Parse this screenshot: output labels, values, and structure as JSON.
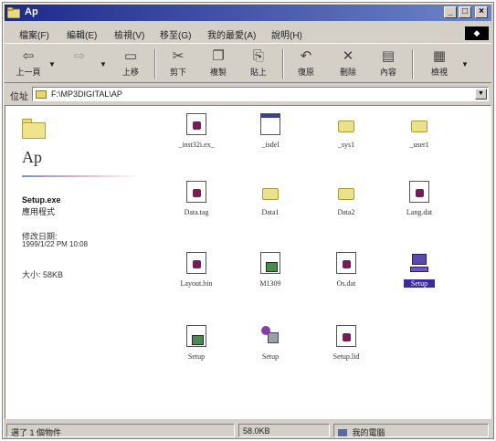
{
  "window": {
    "title": "Ap",
    "min_btn": "_",
    "max_btn": "□",
    "close_btn": "×"
  },
  "menu": {
    "items": [
      "檔案(F)",
      "編輯(E)",
      "檢視(V)",
      "移至(G)",
      "我的最愛(A)",
      "說明(H)"
    ],
    "throbber": "◆"
  },
  "toolbar": {
    "back": {
      "label": "上一頁",
      "glyph": "⇦"
    },
    "forward": {
      "label": "",
      "glyph": "⇨"
    },
    "up": {
      "label": "上移",
      "glyph": "▭"
    },
    "cut": {
      "label": "剪下",
      "glyph": "✂"
    },
    "copy": {
      "label": "複製",
      "glyph": "❐"
    },
    "paste": {
      "label": "貼上",
      "glyph": "⎘"
    },
    "undo": {
      "label": "復原",
      "glyph": "↶"
    },
    "delete": {
      "label": "刪除",
      "glyph": "✕"
    },
    "properties": {
      "label": "內容",
      "glyph": "▤"
    },
    "views": {
      "label": "檢視",
      "glyph": "▦"
    }
  },
  "address": {
    "label": "位址",
    "path": "F:\\MP3DIGITAL\\AP"
  },
  "left_panel": {
    "folder_title": "Ap",
    "file_name": "Setup.exe",
    "file_type": "應用程式",
    "modified_label": "修改日期:",
    "modified_date": "1999/1/22 PM 10:08",
    "size_text": "大小: 58KB"
  },
  "files": [
    {
      "name": "_inst32i.ex_",
      "icon": "document-icon"
    },
    {
      "name": "_isdel",
      "icon": "window-icon"
    },
    {
      "name": "_sys1",
      "icon": "folder-icon"
    },
    {
      "name": "_user1",
      "icon": "folder-icon"
    },
    {
      "name": "Data.tag",
      "icon": "document-icon"
    },
    {
      "name": "Data1",
      "icon": "folder-icon"
    },
    {
      "name": "Data2",
      "icon": "folder-icon"
    },
    {
      "name": "Lang.dat",
      "icon": "document-icon"
    },
    {
      "name": "Layout.bin",
      "icon": "document-icon"
    },
    {
      "name": "M1309",
      "icon": "setup-doc-icon"
    },
    {
      "name": "Os.dat",
      "icon": "document-icon"
    },
    {
      "name": "Setup",
      "icon": "computer-icon"
    },
    {
      "name": "Setup",
      "icon": "setup-doc-icon"
    },
    {
      "name": "Setup",
      "icon": "installer-icon"
    },
    {
      "name": "Setup.lid",
      "icon": "document-icon"
    }
  ],
  "status": {
    "selected": "選了 1 個物件",
    "size": "58.0KB",
    "zone": "我的電腦"
  }
}
